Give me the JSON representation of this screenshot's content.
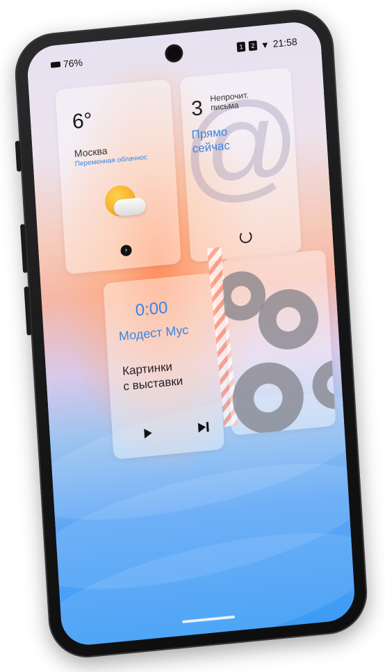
{
  "status_bar": {
    "battery_percent": "76%",
    "sim_1": "1",
    "sim_2": "2",
    "time": "21:58"
  },
  "widgets": {
    "weather": {
      "temperature": "6°",
      "city": "Москва",
      "condition": "Переменная облачнос",
      "icon": "partly-cloudy-icon",
      "action_icon": "chevron-right-circle-icon"
    },
    "mail": {
      "unread_count": "3",
      "unread_label_line1": "Непрочит.",
      "unread_label_line2": "письма",
      "status_line1": "Прямо",
      "status_line2": "сейчас",
      "background_icon": "at-sign-icon",
      "refresh_icon": "refresh-icon"
    },
    "music": {
      "time": "0:00",
      "artist": "Модест Мус",
      "track_line1": "Картинки",
      "track_line2": "с выставки",
      "play_icon": "play-icon",
      "next_icon": "skip-next-icon"
    },
    "settings": {
      "icon": "gear-icon"
    }
  },
  "colors": {
    "accent": "#3a86e3",
    "frame": "#141415",
    "gradient_top": "#e7e2f1",
    "gradient_mid": "#f6b7a5",
    "gradient_bottom": "#3b9bf5"
  }
}
